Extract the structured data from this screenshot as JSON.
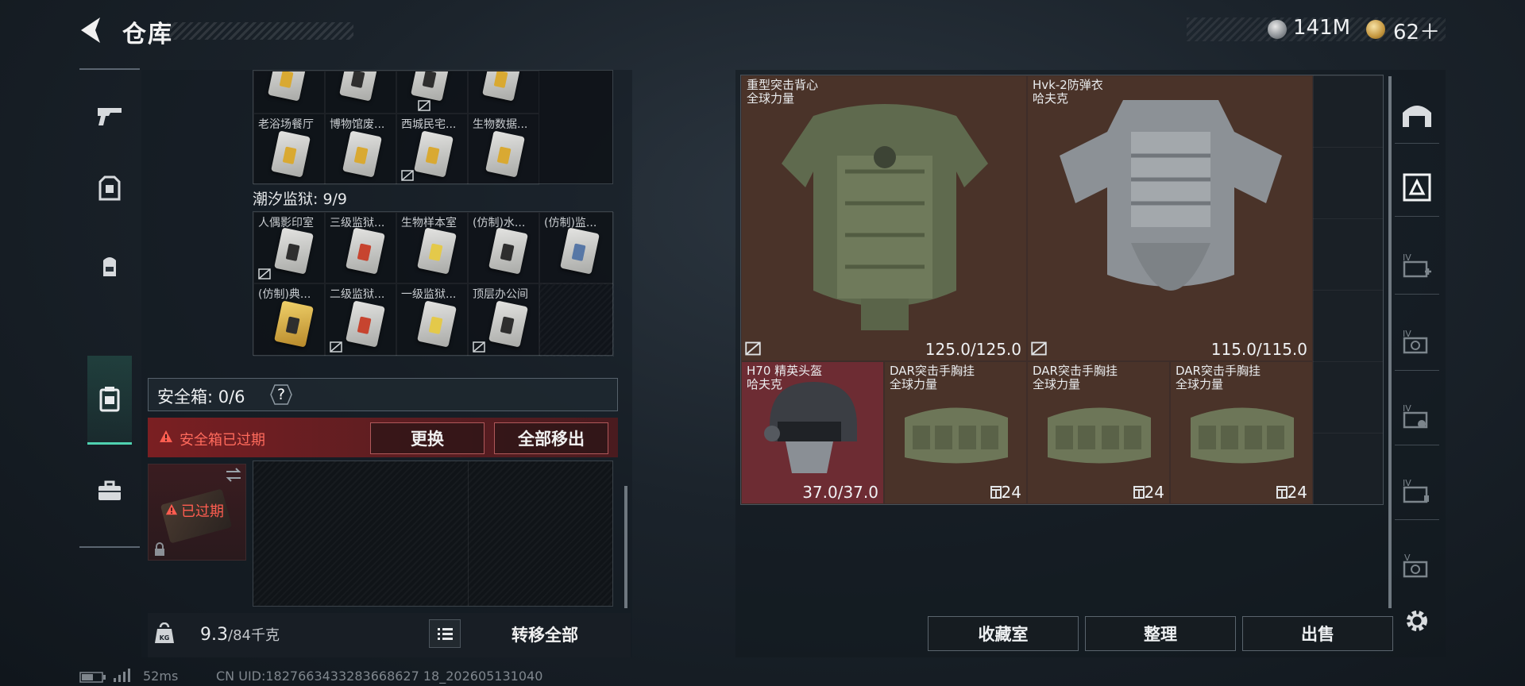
{
  "header": {
    "title": "仓库",
    "currency_silver": "141M",
    "currency_gold": "62＋"
  },
  "nav": {
    "items": [
      {
        "icon": "gun-icon"
      },
      {
        "icon": "backpack-icon"
      },
      {
        "icon": "backpack-icon"
      },
      {
        "icon": "safe-box-icon",
        "active": true
      },
      {
        "icon": "briefcase-icon"
      }
    ]
  },
  "left": {
    "top_cards": {
      "labels": [
        "老浴场餐厅",
        "博物馆废...",
        "西城民宅...",
        "生物数据..."
      ]
    },
    "tide_prison": {
      "title": "潮汐监狱: 9/9",
      "row1": [
        "人偶影印室",
        "三级监狱...",
        "生物样本室",
        "(仿制)水...",
        "(仿制)监..."
      ],
      "row2": [
        "(仿制)典...",
        "二级监狱...",
        "一级监狱...",
        "顶层办公间"
      ]
    },
    "safe_box": {
      "label": "安全箱: 0/6",
      "help": "?",
      "warning": "安全箱已过期",
      "replace_btn": "更换",
      "remove_all_btn": "全部移出",
      "expired_label": "已过期"
    },
    "weight": {
      "current": "9.3",
      "capacity": "/84千克"
    },
    "transfer_all_btn": "转移全部"
  },
  "status": {
    "ping": "52ms",
    "uid": "CN UID:1827663433283668627 18_202605131040"
  },
  "stash": {
    "items": [
      {
        "name": "重型突击背心",
        "brand": "全球力量",
        "value": "125.0/125.0",
        "bg": "brown"
      },
      {
        "name": "Hvk-2防弹衣",
        "brand": "哈夫克",
        "value": "115.0/115.0",
        "bg": "brown"
      },
      {
        "name": "H70 精英头盔",
        "brand": "哈夫克",
        "value": "37.0/37.0",
        "bg": "red"
      },
      {
        "name": "DAR突击手胸挂",
        "brand": "全球力量",
        "value": "24",
        "bg": "brown"
      },
      {
        "name": "DAR突击手胸挂",
        "brand": "全球力量",
        "value": "24",
        "bg": "brown"
      },
      {
        "name": "DAR突击手胸挂",
        "brand": "全球力量",
        "value": "24",
        "bg": "brown"
      }
    ]
  },
  "bottom_buttons": {
    "collection": "收藏室",
    "sort": "整理",
    "sell": "出售"
  },
  "colors": {
    "accent": "#4fd1b0",
    "warning_red": "#ff5d50",
    "armor_brown": "#4a3329",
    "helmet_red": "#6d2c33"
  }
}
